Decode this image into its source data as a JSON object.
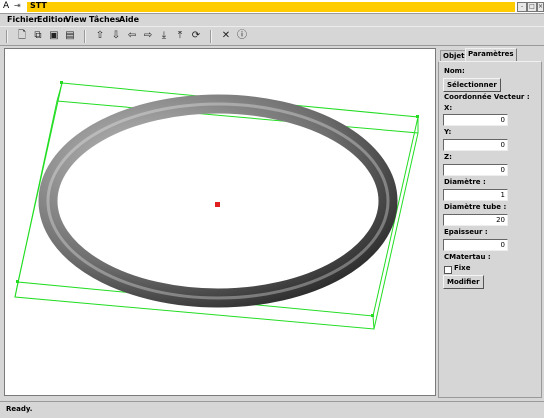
{
  "window": {
    "title": "STT",
    "controls": {
      "minimize": "-",
      "maximize": "□",
      "close": "×"
    }
  },
  "menu": {
    "items": [
      "Fichier",
      "Edition",
      "View",
      "Tâches",
      "Aide"
    ]
  },
  "toolbar": {
    "icons": [
      "new-file-icon",
      "open-file-icon",
      "save-icon",
      "save-as-icon",
      "arrow-up-icon",
      "arrow-down-icon",
      "arrow-left-icon",
      "arrow-right-icon",
      "arrow-bottom-icon",
      "arrow-top-icon",
      "rotate-icon",
      "close-icon",
      "info-icon"
    ]
  },
  "panel": {
    "tabs": [
      "Objets",
      "Paramètres"
    ],
    "active_tab": "Paramètres",
    "nom_label": "Nom:",
    "select_button": "Sélectionner",
    "coords_label": "Coordonnée Vecteur :",
    "x_label": "X:",
    "x_value": "0",
    "y_label": "Y:",
    "y_value": "0",
    "z_label": "Z:",
    "z_value": "0",
    "diam_label": "Diamètre :",
    "diam_value": "1",
    "tube_label": "Diamètre tube :",
    "tube_value": "20",
    "ep_label": "Epaisseur :",
    "ep_value": "0",
    "mat_label": "CMatertau :",
    "fixe_label": "Fixe",
    "fixe_checked": false,
    "modify_button": "Modifier"
  },
  "status": {
    "text": "Ready."
  },
  "colors": {
    "title_accent": "#ffcc00",
    "bbox_green": "#22dd22",
    "center_red": "#e02020"
  }
}
